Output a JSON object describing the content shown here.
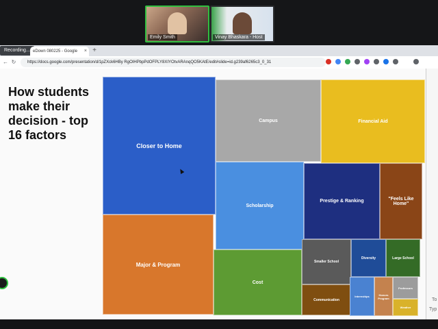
{
  "meeting": {
    "participants": [
      {
        "name": "Emily Smith"
      },
      {
        "name": "Vinay Bhaskara - Host"
      }
    ],
    "recording_label": "Recording..."
  },
  "browser": {
    "tab_title": "eDown 080225 - Google",
    "tab_close": "×",
    "new_tab": "+",
    "url": "https://docs.google.com/presentation/d/1pZXck6HBy RgOIHPbpPdOFPLY8XIYOtvARAnqQO5KAtE/edit#slide=id.g239af6265c3_0_31"
  },
  "slide": {
    "title": "How students make their decision - top 16 factors"
  },
  "chart_data": {
    "type": "treemap",
    "title": "How students make their decision - top 16 factors",
    "items": [
      {
        "label": "Closer to Home",
        "color": "#2b5ec8"
      },
      {
        "label": "Major & Program",
        "color": "#d8772c"
      },
      {
        "label": "Campus",
        "color": "#a8a8a8"
      },
      {
        "label": "Financial Aid",
        "color": "#e9bd1f"
      },
      {
        "label": "Scholarship",
        "color": "#4a8fe0"
      },
      {
        "label": "Prestige & Ranking",
        "color": "#1e2f80"
      },
      {
        "label": "\"Feels Like Home\"",
        "color": "#8a4517"
      },
      {
        "label": "Cost",
        "color": "#5d9b33"
      },
      {
        "label": "Smaller School",
        "color": "#5a5a5a"
      },
      {
        "label": "Diversity",
        "color": "#1f4c98"
      },
      {
        "label": "Large School",
        "color": "#346b26"
      },
      {
        "label": "Communication",
        "color": "#7f4e10"
      },
      {
        "label": "Internships",
        "color": "#4a82d1"
      },
      {
        "label": "Honors Program",
        "color": "#c4824e"
      },
      {
        "label": "Professors",
        "color": "#9c9c9c"
      },
      {
        "label": "Weather",
        "color": "#d9b22a"
      }
    ]
  },
  "side_panel": {
    "line1": "To",
    "line2": "Typ"
  }
}
